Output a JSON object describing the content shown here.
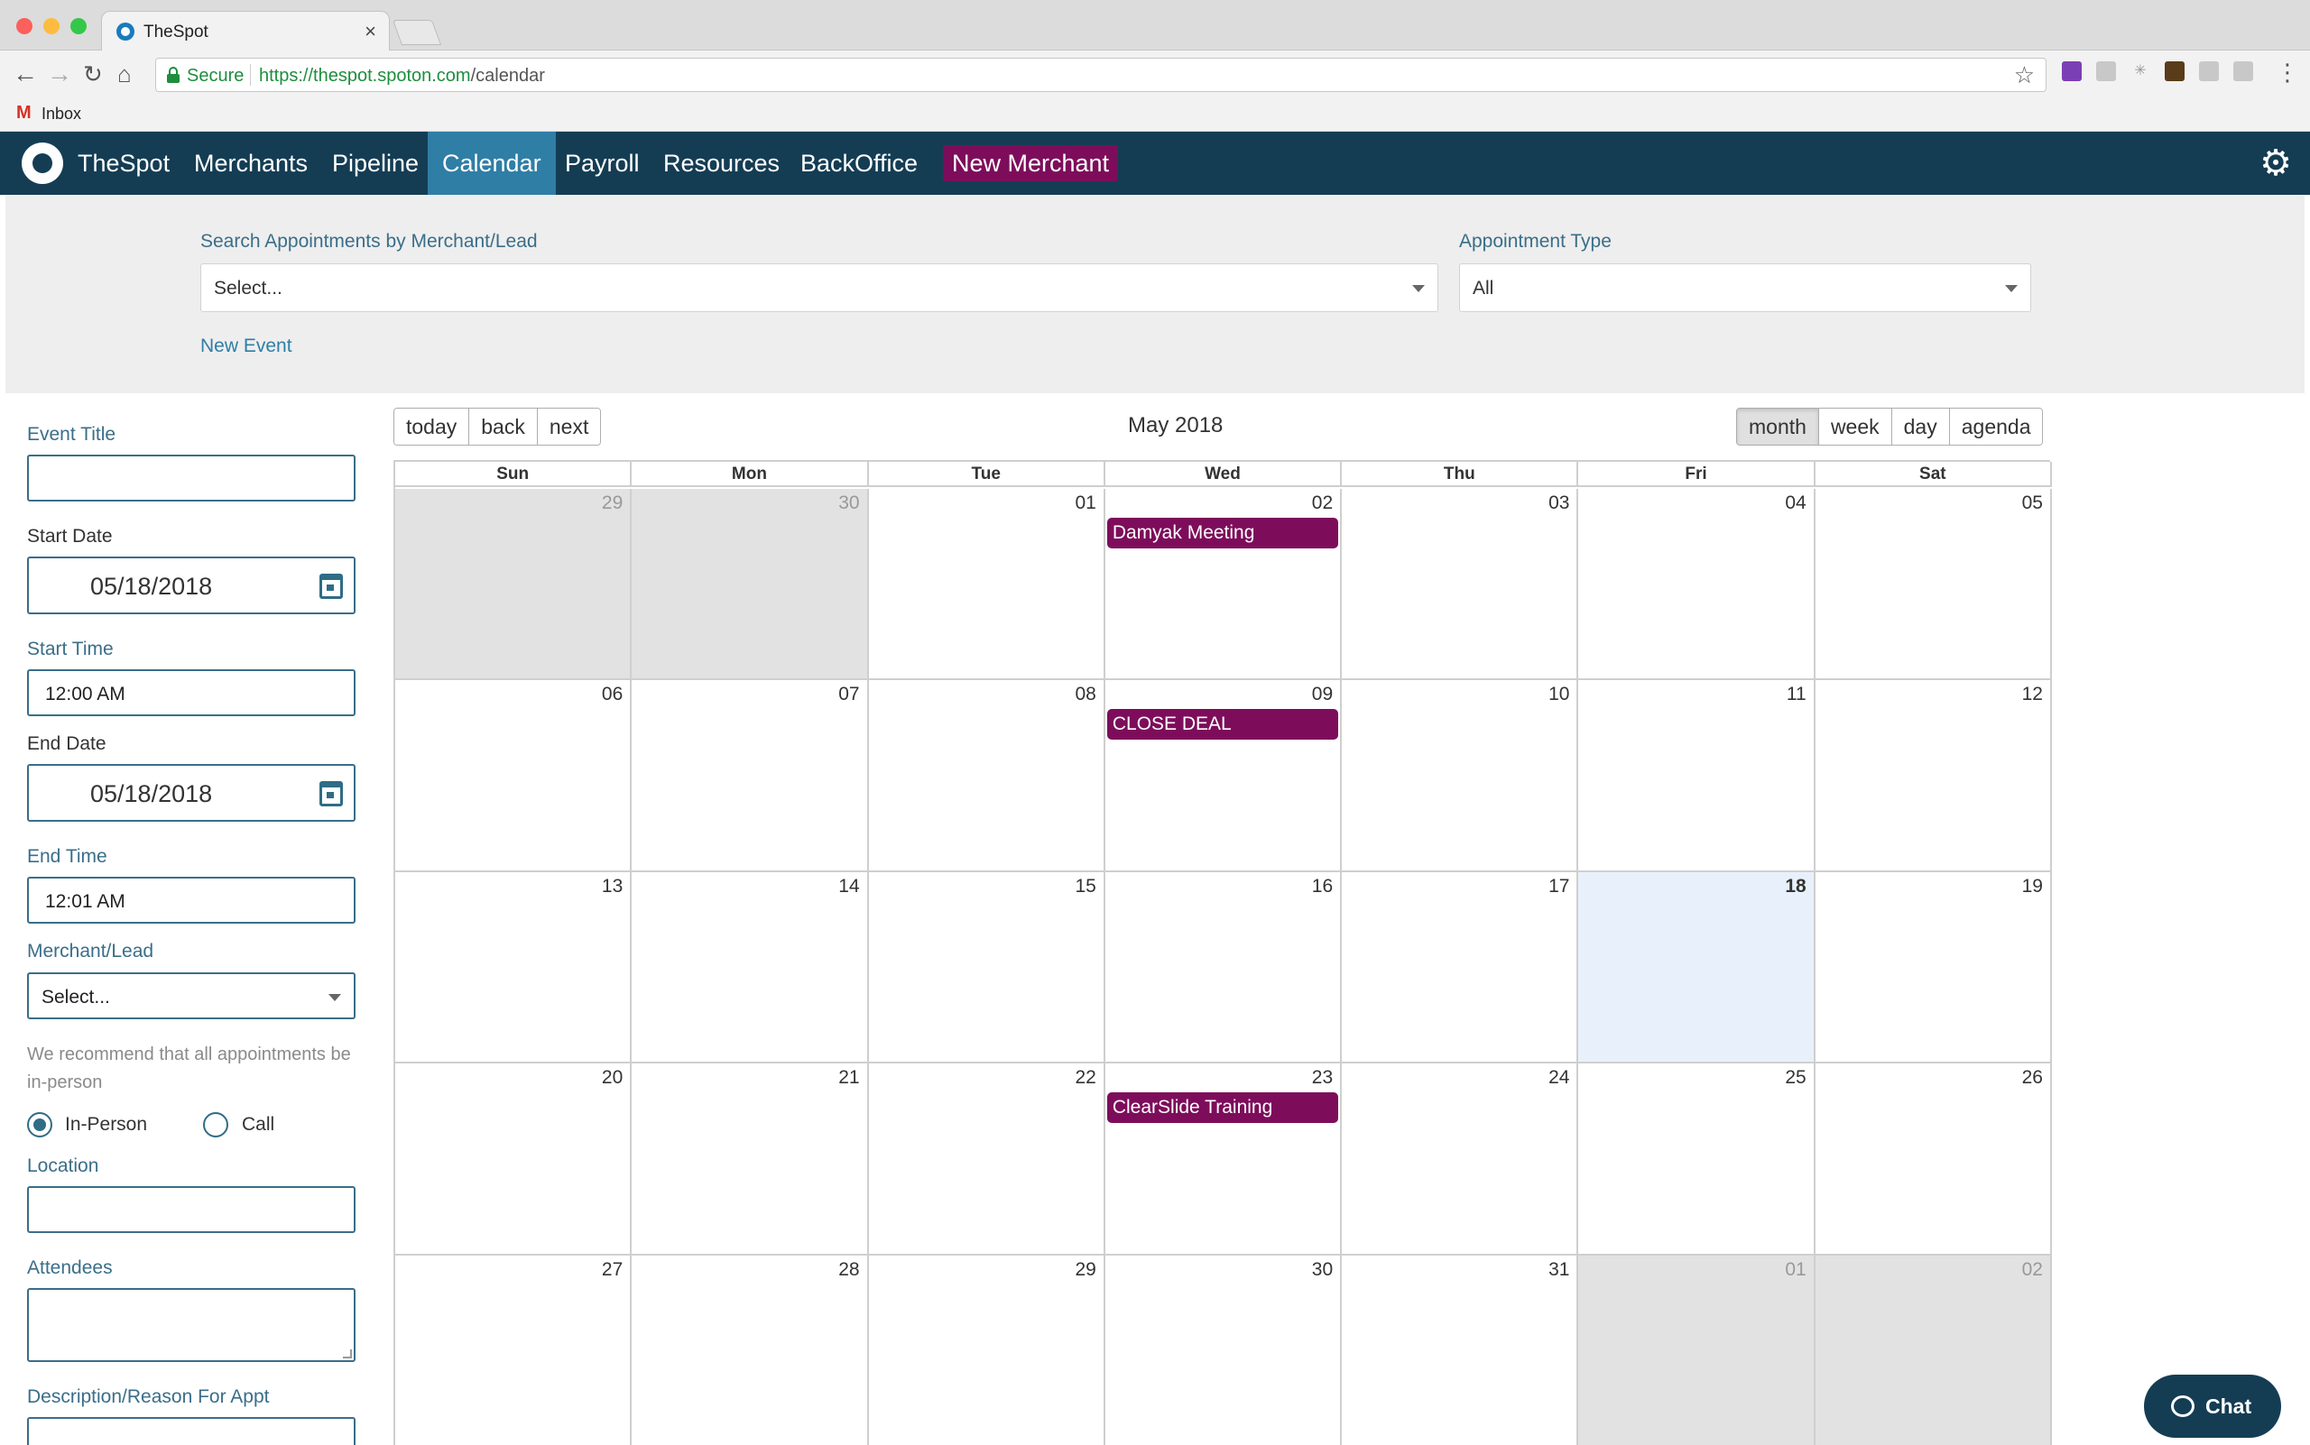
{
  "browser": {
    "tab_title": "TheSpot",
    "tab_close": "×",
    "secure_label": "Secure",
    "url_host": "https://thespot.spoton.com",
    "url_path": "/calendar",
    "bookmark_inbox": "Inbox"
  },
  "nav": {
    "brand": "TheSpot",
    "items": [
      "Merchants",
      "Pipeline",
      "Calendar",
      "Payroll",
      "Resources",
      "BackOffice"
    ],
    "active": "Calendar",
    "new_merchant": "New Merchant"
  },
  "filters": {
    "search_label": "Search Appointments by Merchant/Lead",
    "search_value": "Select...",
    "type_label": "Appointment Type",
    "type_value": "All",
    "new_event": "New Event"
  },
  "form": {
    "event_title_label": "Event Title",
    "event_title_value": "",
    "start_date_label": "Start Date",
    "start_date_value": "05/18/2018",
    "start_time_label": "Start Time",
    "start_time_value": "12:00 AM",
    "end_date_label": "End Date",
    "end_date_value": "05/18/2018",
    "end_time_label": "End Time",
    "end_time_value": "12:01 AM",
    "merchant_label": "Merchant/Lead",
    "merchant_value": "Select...",
    "recommendation": "We recommend that all appointments be in-person",
    "mode_options": [
      "In-Person",
      "Call"
    ],
    "mode_selected": "In-Person",
    "location_label": "Location",
    "attendees_label": "Attendees",
    "description_label": "Description/Reason For Appt"
  },
  "calendar": {
    "title": "May 2018",
    "nav_buttons": [
      "today",
      "back",
      "next"
    ],
    "view_buttons": [
      "month",
      "week",
      "day",
      "agenda"
    ],
    "active_view": "month",
    "weekdays": [
      "Sun",
      "Mon",
      "Tue",
      "Wed",
      "Thu",
      "Fri",
      "Sat"
    ],
    "today_date": "18",
    "weeks": [
      [
        {
          "d": "29",
          "off": true
        },
        {
          "d": "30",
          "off": true
        },
        {
          "d": "01"
        },
        {
          "d": "02",
          "event": "Damyak Meeting"
        },
        {
          "d": "03"
        },
        {
          "d": "04"
        },
        {
          "d": "05"
        }
      ],
      [
        {
          "d": "06"
        },
        {
          "d": "07"
        },
        {
          "d": "08"
        },
        {
          "d": "09",
          "event": "CLOSE DEAL"
        },
        {
          "d": "10"
        },
        {
          "d": "11"
        },
        {
          "d": "12"
        }
      ],
      [
        {
          "d": "13"
        },
        {
          "d": "14"
        },
        {
          "d": "15"
        },
        {
          "d": "16"
        },
        {
          "d": "17"
        },
        {
          "d": "18",
          "today": true
        },
        {
          "d": "19"
        }
      ],
      [
        {
          "d": "20"
        },
        {
          "d": "21"
        },
        {
          "d": "22"
        },
        {
          "d": "23",
          "event": "ClearSlide Training"
        },
        {
          "d": "24"
        },
        {
          "d": "25"
        },
        {
          "d": "26"
        }
      ],
      [
        {
          "d": "27"
        },
        {
          "d": "28"
        },
        {
          "d": "29"
        },
        {
          "d": "30"
        },
        {
          "d": "31"
        },
        {
          "d": "01",
          "off": true
        },
        {
          "d": "02",
          "off": true
        }
      ]
    ]
  },
  "chat": {
    "label": "Chat"
  },
  "colors": {
    "nav_bg": "#143d54",
    "accent": "#2f7ea6",
    "event": "#7d0d5b",
    "today_bg": "#e8f1fb"
  }
}
